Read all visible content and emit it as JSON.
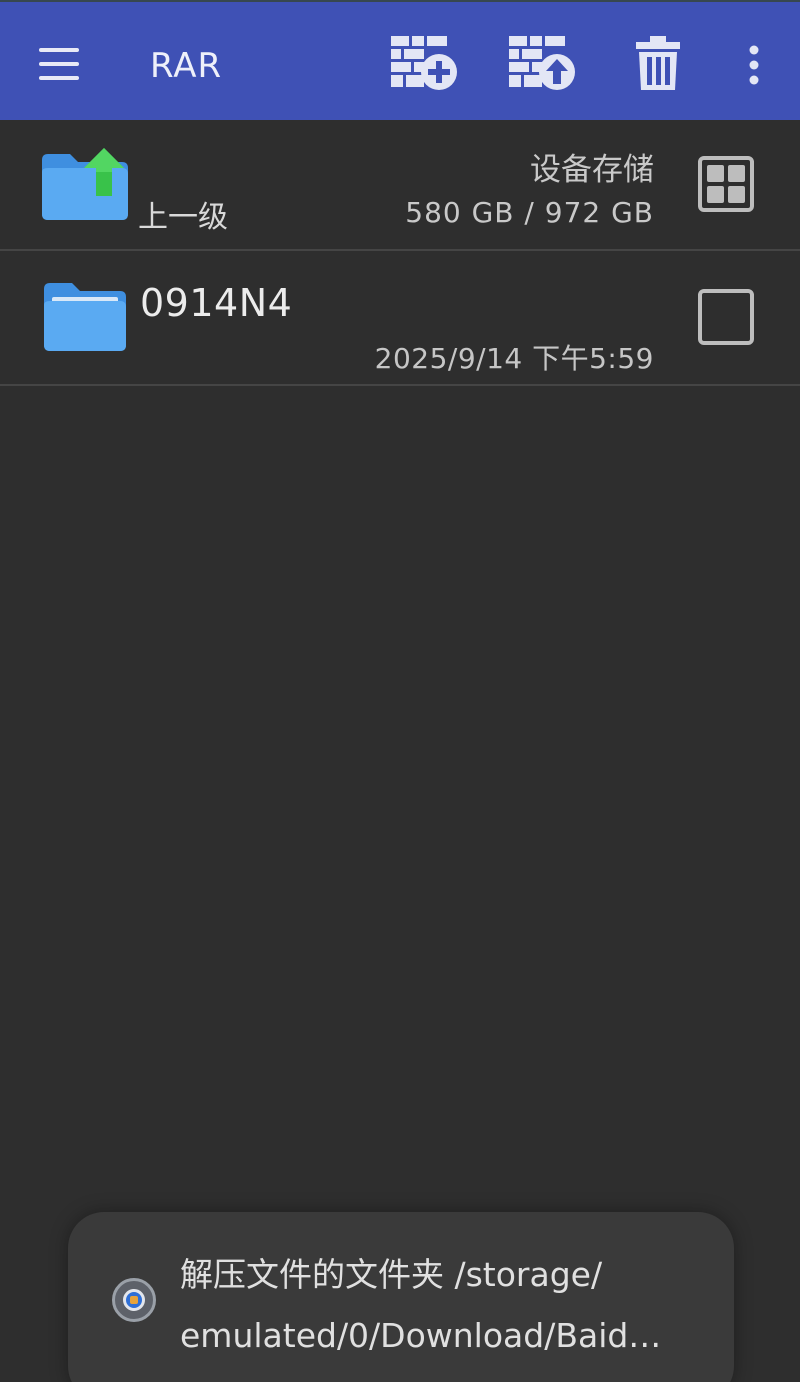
{
  "toolbar": {
    "title": "RAR",
    "menu_icon": "hamburger-menu-icon",
    "add_icon": "archive-add-icon",
    "extract_icon": "archive-extract-icon",
    "delete_icon": "trash-icon",
    "more_icon": "more-vertical-icon",
    "background": "#3f51b5"
  },
  "list": {
    "parent": {
      "name": "上一级",
      "storage_label": "设备存储",
      "storage_size": "580 GB / 972 GB"
    },
    "items": [
      {
        "name": "0914N4",
        "date": "2025/9/14 下午5:59",
        "checked": false
      }
    ]
  },
  "toast": {
    "line1": "解压文件的文件夹 /storage/",
    "line2": "emulated/0/Download/Baid…"
  }
}
